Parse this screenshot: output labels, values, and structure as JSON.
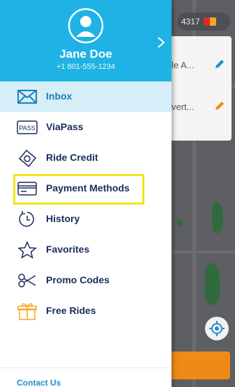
{
  "map": {
    "top_pill_text": "4317",
    "card_row_1": "le A...",
    "card_row_2": "vert..."
  },
  "drawer": {
    "user_name": "Jane Doe",
    "user_phone": "+1 801-555-1234",
    "menu": [
      {
        "label": "Inbox",
        "icon": "mail-icon",
        "active": true
      },
      {
        "label": "ViaPass",
        "icon": "pass-icon",
        "icon_text": "PASS"
      },
      {
        "label": "Ride Credit",
        "icon": "ride-credit-icon"
      },
      {
        "label": "Payment Methods",
        "icon": "credit-card-icon"
      },
      {
        "label": "History",
        "icon": "history-icon"
      },
      {
        "label": "Favorites",
        "icon": "star-icon"
      },
      {
        "label": "Promo Codes",
        "icon": "scissors-icon"
      },
      {
        "label": "Free Rides",
        "icon": "gift-icon"
      }
    ],
    "contact_label": "Contact Us"
  },
  "colors": {
    "header_bg": "#1eb3e4",
    "active_bg": "#d5eef8",
    "label_color": "#1b2a5c",
    "highlight_border": "#f3e613",
    "contact_color": "#1e8ed0"
  }
}
